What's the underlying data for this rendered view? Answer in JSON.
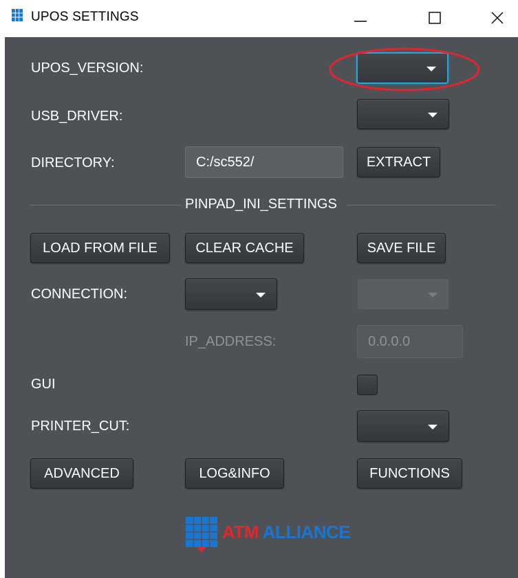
{
  "window": {
    "title": "UPOS SETTINGS",
    "controls": [
      "minimize",
      "maximize",
      "close"
    ]
  },
  "fields": {
    "upos_version": {
      "label": "UPOS_VERSION:",
      "value": ""
    },
    "usb_driver": {
      "label": "USB_DRIVER:",
      "value": ""
    },
    "directory": {
      "label": "DIRECTORY:",
      "value": "C:/sc552/"
    },
    "extract_label": "EXTRACT"
  },
  "pinpad": {
    "section_title": "PINPAD_INI_SETTINGS",
    "load_from_file": "LOAD FROM FILE",
    "clear_cache": "CLEAR CACHE",
    "save_file": "SAVE FILE",
    "connection_label": "CONNECTION:",
    "ip_address_label": "IP_ADDRESS:",
    "ip_address_value": "0.0.0.0",
    "gui_label": "GUI",
    "printer_cut_label": "PRINTER_CUT:"
  },
  "bottom_buttons": {
    "advanced": "ADVANCED",
    "log_info": "LOG&INFO",
    "functions": "FUNCTIONS"
  },
  "logo": {
    "word1": "ATM",
    "word2": "ALLIANCE"
  },
  "colors": {
    "panel_bg": "#4e5257",
    "focus_accent": "#2da3d6",
    "annotation_red": "#e0262d",
    "logo_red": "#e4262b",
    "logo_blue": "#1976d2"
  }
}
